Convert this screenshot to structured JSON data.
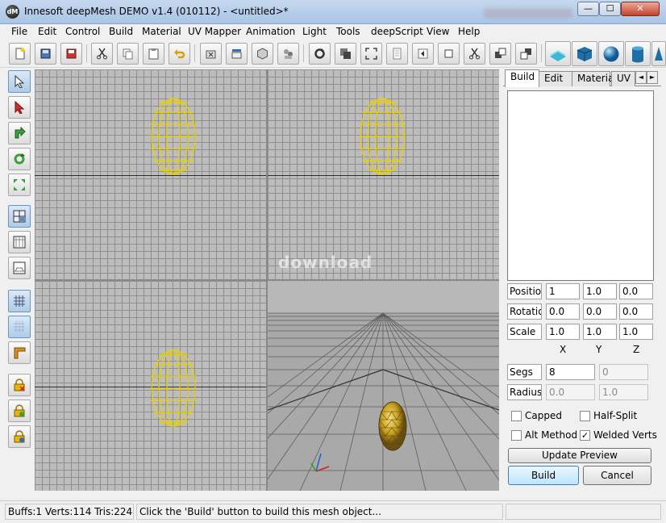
{
  "window": {
    "title": "Innesoft deepMesh DEMO v1.4 (010112) - <untitled>*",
    "icon_text": "dM",
    "minimize_glyph": "—",
    "maximize_glyph": "☐",
    "close_glyph": "✕"
  },
  "menu": [
    "File",
    "Edit",
    "Control",
    "Build",
    "Material",
    "UV Mapper",
    "Animation",
    "Light",
    "Tools",
    "deepScript",
    "View",
    "Help"
  ],
  "toolbar_icons": [
    "new-file-icon",
    "open-icon",
    "save-icon",
    "cut-icon",
    "copy-icon",
    "paste-icon",
    "undo-icon",
    "delete-buffer-icon",
    "select-buffer-icon",
    "mesh-box-icon",
    "group-icon",
    "refresh-icon",
    "stack-icon",
    "fit-view-icon",
    "page-icon",
    "import-icon",
    "box-outline-icon",
    "scissors-icon",
    "merge-icon",
    "split-icon",
    "wave-plane-icon",
    "cube-icon",
    "sphere-icon",
    "cylinder-icon"
  ],
  "left_tools": [
    "select-arrow-icon",
    "pointer-red-icon",
    "move-icon",
    "rotate-icon",
    "scale-icon",
    "quad-view-icon",
    "front-view-icon",
    "perspective-view-icon",
    "grid-icon",
    "dot-grid-icon",
    "corner-icon",
    "lock-delete-icon",
    "lock-add-icon",
    "lock-edit-icon"
  ],
  "watermark": "download",
  "panel": {
    "tabs": [
      "Build",
      "Edit",
      "Material",
      "UV"
    ],
    "tab_prev": "◄",
    "tab_next": "►",
    "position": {
      "label": "Position",
      "x": "1",
      "y": "1.0",
      "z": "0.0"
    },
    "rotation": {
      "label": "Rotation",
      "x": "0.0",
      "y": "0.0",
      "z": "0.0"
    },
    "scale": {
      "label": "Scale",
      "x": "1.0",
      "y": "1.0",
      "z": "1.0"
    },
    "axis_labels": [
      "X",
      "Y",
      "Z"
    ],
    "segs": {
      "label": "Segs",
      "value1": "8",
      "value2": "0"
    },
    "radius": {
      "label": "Radius",
      "value1": "0.0",
      "value2": "1.0"
    },
    "checkboxes": [
      {
        "label": "Capped",
        "checked": false
      },
      {
        "label": "Half-Split",
        "checked": false
      },
      {
        "label": "Alt Method",
        "checked": false
      },
      {
        "label": "Welded Verts",
        "checked": true
      }
    ],
    "check_mark": "✓",
    "update_preview": "Update Preview",
    "build": "Build",
    "cancel": "Cancel"
  },
  "status": {
    "stats": "Buffs:1 Verts:114 Tris:224",
    "message": "Click the 'Build' button to build this mesh object..."
  },
  "colors": {
    "egg": "#e8d000",
    "egg_solid": "#c8a020",
    "grid": "#8f8f8f",
    "viewport_bg": "#bdbdbd"
  }
}
